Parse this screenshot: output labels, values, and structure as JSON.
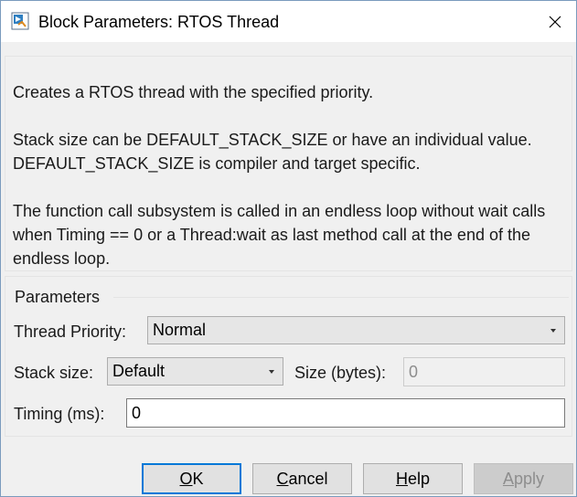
{
  "window": {
    "title": "Block Parameters: RTOS Thread"
  },
  "description": {
    "line1": "Creates a RTOS thread with the specified priority.",
    "line2": "Stack size can be DEFAULT_STACK_SIZE or have an individual value. DEFAULT_STACK_SIZE is compiler and target specific.",
    "line3": "The function call subsystem is called in an endless loop without wait calls when Timing == 0 or a Thread:wait as last method call at the end of the endless loop."
  },
  "parameters": {
    "group_title": "Parameters",
    "thread_priority_label": "Thread Priority:",
    "thread_priority_value": "Normal",
    "stack_size_label": "Stack size:",
    "stack_size_value": "Default",
    "size_bytes_label": "Size (bytes):",
    "size_bytes_value": "0",
    "timing_label": "Timing (ms):",
    "timing_value": "0"
  },
  "buttons": {
    "ok": {
      "mnemonic": "O",
      "rest": "K"
    },
    "cancel": {
      "mnemonic": "C",
      "rest": "ancel"
    },
    "help": {
      "mnemonic": "H",
      "rest": "elp"
    },
    "apply": {
      "mnemonic": "A",
      "rest": "pply"
    }
  },
  "icons": {
    "app": "simulink-block-icon",
    "close": "close-icon",
    "dropdown": "chevron-down-icon"
  }
}
